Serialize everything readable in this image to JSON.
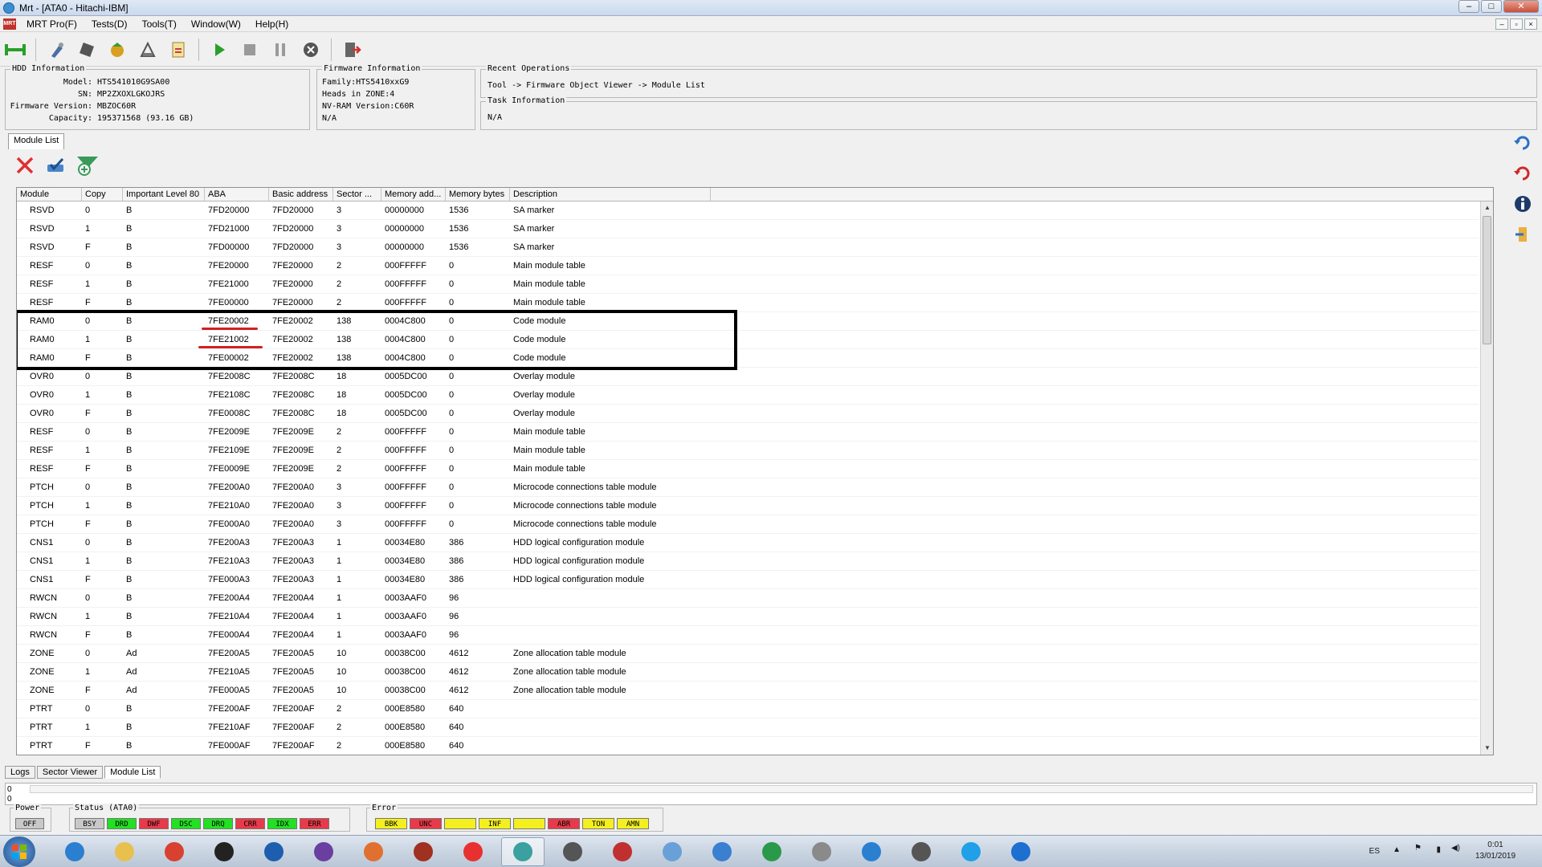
{
  "window": {
    "title": "Mrt - [ATA0 - Hitachi-IBM]",
    "controls": [
      "–",
      "□",
      "✕"
    ],
    "mdi_controls": [
      "–",
      "▫",
      "×"
    ]
  },
  "menu": {
    "logo_text": "MRT",
    "items": [
      "MRT Pro(F)",
      "Tests(D)",
      "Tools(T)",
      "Window(W)",
      "Help(H)"
    ]
  },
  "toolbar": {
    "buttons": [
      "connect-icon",
      "tool-icon",
      "chip-icon",
      "module-icon",
      "flash-icon",
      "report-icon",
      "play-icon",
      "stop-icon",
      "pause-icon",
      "cancel-icon",
      "exit-icon"
    ]
  },
  "hdd_info": {
    "legend": "HDD Information",
    "model_label": "Model:",
    "model": "HTS541010G9SA00",
    "sn_label": "SN:",
    "sn": "MP2ZXOXLGKOJRS",
    "fw_label": "Firmware Version:",
    "fw": "MBZOC60R",
    "cap_label": "Capacity:",
    "cap": "195371568 (93.16 GB)"
  },
  "fw_info": {
    "legend": "Firmware Information",
    "family": "Family:HTS5410xxG9",
    "heads": "Heads in ZONE:4",
    "nvram": "NV-RAM Version:C60R",
    "extra": "N/A"
  },
  "recent_ops": {
    "legend": "Recent Operations",
    "text": "Tool -> Firmware Object Viewer -> Module List"
  },
  "task_info": {
    "legend": "Task Information",
    "text": "N/A"
  },
  "module_tab": "Module List",
  "list_tools": [
    "delete-icon",
    "check-icon",
    "add-filter-icon"
  ],
  "columns": [
    "Module",
    "Copy",
    "Important Level 80",
    "ABA",
    "Basic address",
    "Sector ...",
    "Memory add...",
    "Memory bytes",
    "Description"
  ],
  "rows": [
    [
      "RSVD",
      "0",
      "B",
      "7FD20000",
      "7FD20000",
      "3",
      "00000000",
      "1536",
      "SA marker"
    ],
    [
      "RSVD",
      "1",
      "B",
      "7FD21000",
      "7FD20000",
      "3",
      "00000000",
      "1536",
      "SA marker"
    ],
    [
      "RSVD",
      "F",
      "B",
      "7FD00000",
      "7FD20000",
      "3",
      "00000000",
      "1536",
      "SA marker"
    ],
    [
      "RESF",
      "0",
      "B",
      "7FE20000",
      "7FE20000",
      "2",
      "000FFFFF",
      "0",
      "Main module table"
    ],
    [
      "RESF",
      "1",
      "B",
      "7FE21000",
      "7FE20000",
      "2",
      "000FFFFF",
      "0",
      "Main module table"
    ],
    [
      "RESF",
      "F",
      "B",
      "7FE00000",
      "7FE20000",
      "2",
      "000FFFFF",
      "0",
      "Main module table"
    ],
    [
      "RAM0",
      "0",
      "B",
      "7FE20002",
      "7FE20002",
      "138",
      "0004C800",
      "0",
      "Code module"
    ],
    [
      "RAM0",
      "1",
      "B",
      "7FE21002",
      "7FE20002",
      "138",
      "0004C800",
      "0",
      "Code module"
    ],
    [
      "RAM0",
      "F",
      "B",
      "7FE00002",
      "7FE20002",
      "138",
      "0004C800",
      "0",
      "Code module"
    ],
    [
      "OVR0",
      "0",
      "B",
      "7FE2008C",
      "7FE2008C",
      "18",
      "0005DC00",
      "0",
      "Overlay module"
    ],
    [
      "OVR0",
      "1",
      "B",
      "7FE2108C",
      "7FE2008C",
      "18",
      "0005DC00",
      "0",
      "Overlay module"
    ],
    [
      "OVR0",
      "F",
      "B",
      "7FE0008C",
      "7FE2008C",
      "18",
      "0005DC00",
      "0",
      "Overlay module"
    ],
    [
      "RESF",
      "0",
      "B",
      "7FE2009E",
      "7FE2009E",
      "2",
      "000FFFFF",
      "0",
      "Main module table"
    ],
    [
      "RESF",
      "1",
      "B",
      "7FE2109E",
      "7FE2009E",
      "2",
      "000FFFFF",
      "0",
      "Main module table"
    ],
    [
      "RESF",
      "F",
      "B",
      "7FE0009E",
      "7FE2009E",
      "2",
      "000FFFFF",
      "0",
      "Main module table"
    ],
    [
      "PTCH",
      "0",
      "B",
      "7FE200A0",
      "7FE200A0",
      "3",
      "000FFFFF",
      "0",
      "Microcode connections table module"
    ],
    [
      "PTCH",
      "1",
      "B",
      "7FE210A0",
      "7FE200A0",
      "3",
      "000FFFFF",
      "0",
      "Microcode connections table module"
    ],
    [
      "PTCH",
      "F",
      "B",
      "7FE000A0",
      "7FE200A0",
      "3",
      "000FFFFF",
      "0",
      "Microcode connections table module"
    ],
    [
      "CNS1",
      "0",
      "B",
      "7FE200A3",
      "7FE200A3",
      "1",
      "00034E80",
      "386",
      "HDD logical configuration module"
    ],
    [
      "CNS1",
      "1",
      "B",
      "7FE210A3",
      "7FE200A3",
      "1",
      "00034E80",
      "386",
      "HDD logical configuration module"
    ],
    [
      "CNS1",
      "F",
      "B",
      "7FE000A3",
      "7FE200A3",
      "1",
      "00034E80",
      "386",
      "HDD logical configuration module"
    ],
    [
      "RWCN",
      "0",
      "B",
      "7FE200A4",
      "7FE200A4",
      "1",
      "0003AAF0",
      "96",
      ""
    ],
    [
      "RWCN",
      "1",
      "B",
      "7FE210A4",
      "7FE200A4",
      "1",
      "0003AAF0",
      "96",
      ""
    ],
    [
      "RWCN",
      "F",
      "B",
      "7FE000A4",
      "7FE200A4",
      "1",
      "0003AAF0",
      "96",
      ""
    ],
    [
      "ZONE",
      "0",
      "Ad",
      "7FE200A5",
      "7FE200A5",
      "10",
      "00038C00",
      "4612",
      "Zone allocation table module"
    ],
    [
      "ZONE",
      "1",
      "Ad",
      "7FE210A5",
      "7FE200A5",
      "10",
      "00038C00",
      "4612",
      "Zone allocation table module"
    ],
    [
      "ZONE",
      "F",
      "Ad",
      "7FE000A5",
      "7FE200A5",
      "10",
      "00038C00",
      "4612",
      "Zone allocation table module"
    ],
    [
      "PTRT",
      "0",
      "B",
      "7FE200AF",
      "7FE200AF",
      "2",
      "000E8580",
      "640",
      ""
    ],
    [
      "PTRT",
      "1",
      "B",
      "7FE210AF",
      "7FE200AF",
      "2",
      "000E8580",
      "640",
      ""
    ],
    [
      "PTRT",
      "F",
      "B",
      "7FE000AF",
      "7FE200AF",
      "2",
      "000E8580",
      "640",
      ""
    ]
  ],
  "highlighted_rows": [
    6,
    7,
    8
  ],
  "underlined_cells": [
    [
      6,
      3
    ],
    [
      7,
      3
    ]
  ],
  "highlight_color": "#000000",
  "underline_color": "#d22020",
  "sidebar_icons": [
    "undo-icon",
    "redo-icon",
    "info-icon",
    "export-icon"
  ],
  "bottom_tabs": [
    "Logs",
    "Sector Viewer",
    "Module List"
  ],
  "log_lines": [
    "0",
    "0"
  ],
  "power": {
    "legend": "Power",
    "items": [
      {
        "label": "OFF",
        "color": "#c8c8c8"
      }
    ]
  },
  "status": {
    "legend": "Status (ATA0)",
    "items": [
      {
        "label": "BSY",
        "color": "#c8c8c8"
      },
      {
        "label": "DRD",
        "color": "#22e022"
      },
      {
        "label": "DWF",
        "color": "#e83a4a"
      },
      {
        "label": "DSC",
        "color": "#22e022"
      },
      {
        "label": "DRQ",
        "color": "#22e022"
      },
      {
        "label": "CRR",
        "color": "#e83a4a"
      },
      {
        "label": "IDX",
        "color": "#22e022"
      },
      {
        "label": "ERR",
        "color": "#e83a4a"
      }
    ]
  },
  "error": {
    "legend": "Error",
    "items": [
      {
        "label": "BBK",
        "color": "#f4f020"
      },
      {
        "label": "UNC",
        "color": "#e83a4a"
      },
      {
        "label": "",
        "color": "#f4f020"
      },
      {
        "label": "INF",
        "color": "#f4f020"
      },
      {
        "label": "",
        "color": "#f4f020"
      },
      {
        "label": "ABR",
        "color": "#e83a4a"
      },
      {
        "label": "TON",
        "color": "#f4f020"
      },
      {
        "label": "AMN",
        "color": "#f4f020"
      }
    ]
  },
  "taskbar": {
    "items": [
      "ie-icon",
      "folder-icon",
      "chrome-icon",
      "terminal-icon",
      "mrt-tool-icon",
      "pie-app-icon",
      "office-icon",
      "archive-icon",
      "game-icon",
      "mrt-icon",
      "hxd-icon",
      "bios-icon",
      "network-icon",
      "t-app-icon",
      "fan-icon",
      "calculator-icon",
      "capture-icon",
      "printer-icon",
      "skype-icon",
      "teamviewer-icon"
    ],
    "active_index": 9,
    "lang": "ES",
    "time": "0:01",
    "date": "13/01/2019"
  }
}
